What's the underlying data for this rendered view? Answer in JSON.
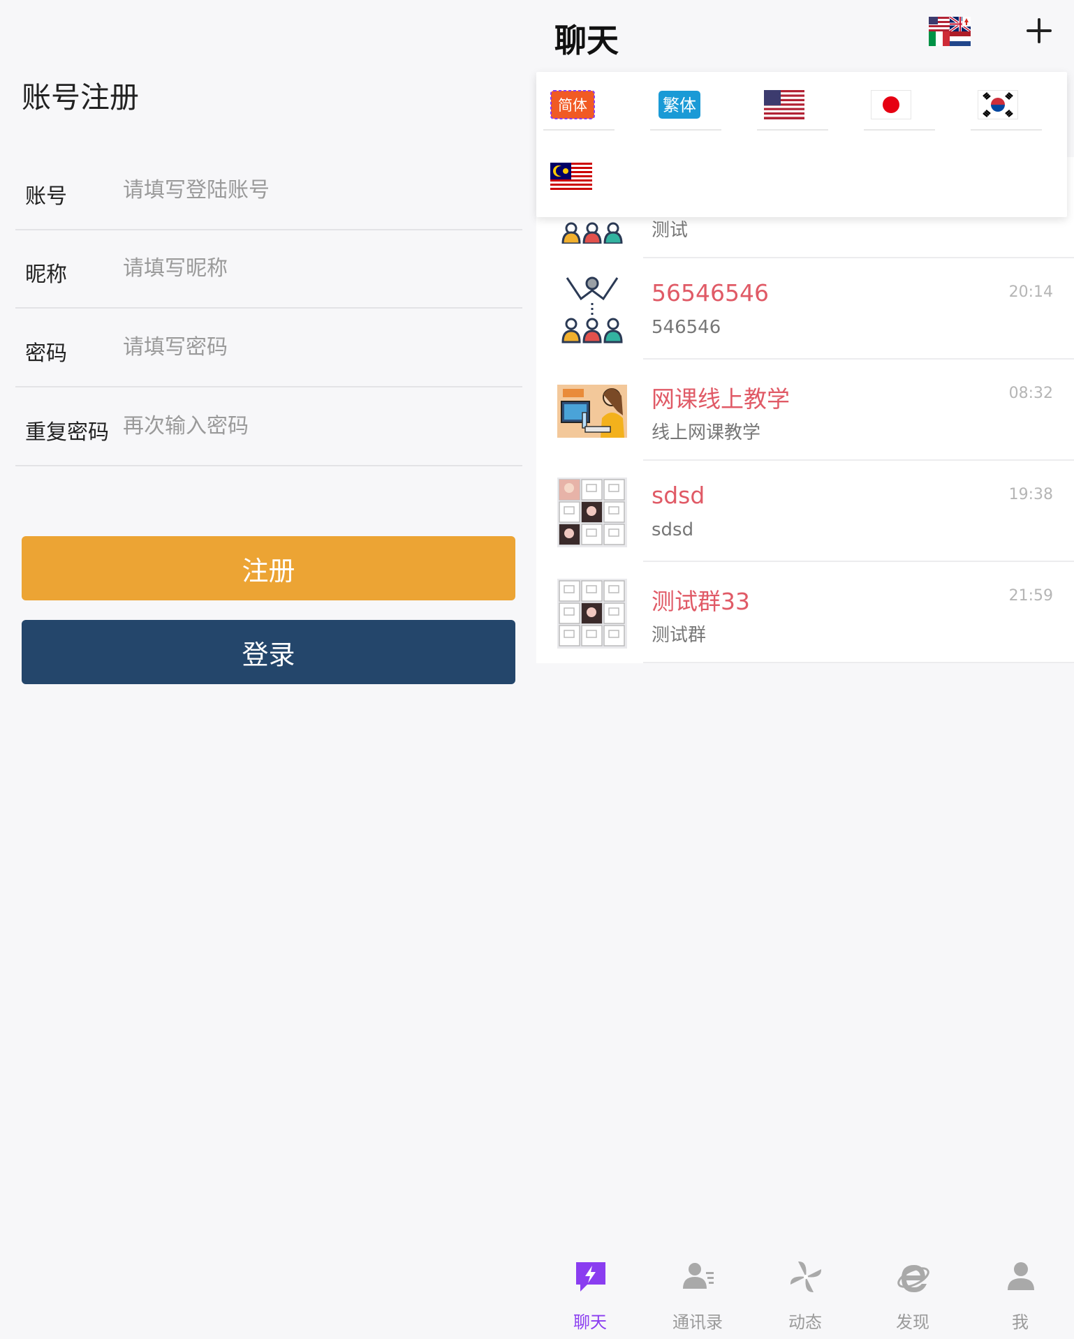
{
  "register": {
    "title": "账号注册",
    "fields": [
      {
        "label": "账号",
        "placeholder": "请填写登陆账号",
        "value": ""
      },
      {
        "label": "昵称",
        "placeholder": "请填写昵称",
        "value": ""
      },
      {
        "label": "密码",
        "placeholder": "请填写密码",
        "value": ""
      },
      {
        "label": "重复密码",
        "placeholder": "再次输入密码",
        "value": ""
      }
    ],
    "register_label": "注册",
    "login_label": "登录",
    "colors": {
      "register": "#eca434",
      "login": "#24466b"
    }
  },
  "chat": {
    "title": "聊天",
    "language_icon": "multi-flag-icon",
    "add_icon": "plus-icon",
    "language_menu": [
      {
        "key": "zh-hans",
        "text": "简体",
        "icon": "simplified-chinese-icon"
      },
      {
        "key": "zh-hant",
        "text": "繁体",
        "icon": "traditional-chinese-icon"
      },
      {
        "key": "en",
        "icon": "us-flag-icon"
      },
      {
        "key": "ja",
        "icon": "japan-flag-icon"
      },
      {
        "key": "ko",
        "icon": "korea-flag-icon"
      },
      {
        "key": "ms",
        "icon": "malaysia-flag-icon"
      }
    ],
    "conversations": [
      {
        "name": "",
        "preview": "测试",
        "time": "",
        "avatar": "group-people-icon"
      },
      {
        "name": "56546546",
        "preview": "546546",
        "time": "20:14",
        "avatar": "group-people-icon"
      },
      {
        "name": "网课线上教学",
        "preview": "线上网课教学",
        "time": "08:32",
        "avatar": "online-class-avatar"
      },
      {
        "name": "sdsd",
        "preview": "sdsd",
        "time": "19:38",
        "avatar": "group-grid-avatar"
      },
      {
        "name": "测试群33",
        "preview": "测试群",
        "time": "21:59",
        "avatar": "group-grid-avatar"
      }
    ],
    "accent_name_color": "#e05a66"
  },
  "tabbar": [
    {
      "label": "聊天",
      "icon": "chat-bolt-icon",
      "active": true
    },
    {
      "label": "通讯录",
      "icon": "contacts-icon",
      "active": false
    },
    {
      "label": "动态",
      "icon": "pinwheel-icon",
      "active": false
    },
    {
      "label": "发现",
      "icon": "browser-e-icon",
      "active": false
    },
    {
      "label": "我",
      "icon": "person-icon",
      "active": false
    }
  ],
  "active_tab_color": "#8a3df0"
}
